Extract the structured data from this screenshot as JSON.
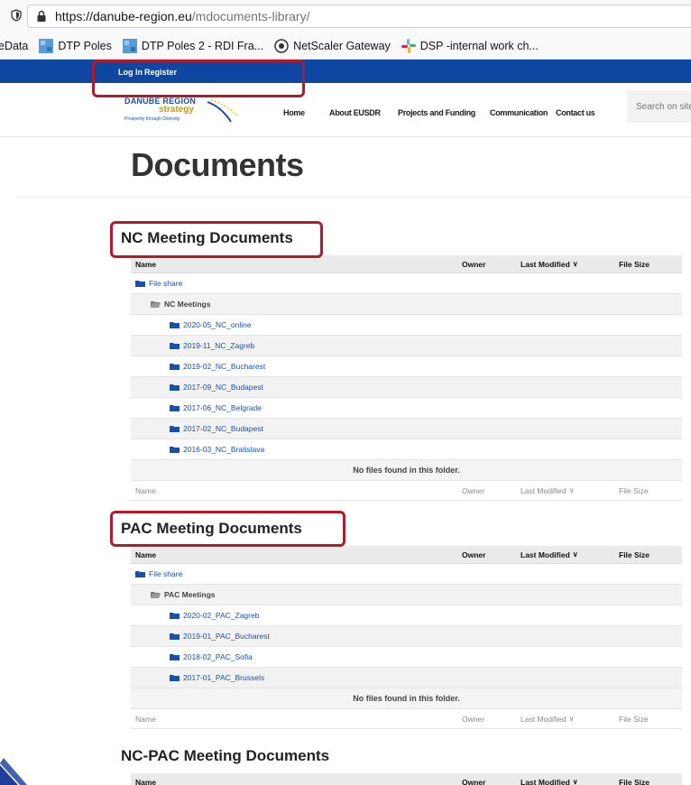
{
  "browser": {
    "url_host": "https://danube-region.eu",
    "url_path": "/mdocuments-library/",
    "bookmarks": [
      "eData",
      "DTP Poles",
      "DTP Poles 2 - RDI Fra...",
      "NetScaler Gateway",
      "DSP -internal work ch..."
    ]
  },
  "site": {
    "login": "Log In",
    "register": "Register",
    "logo_main": "DANUBE REGION",
    "logo_sub": "strategy",
    "logo_tag": "Prosperity through Diversity",
    "nav": [
      "Home",
      "About EUSDR",
      "Projects and Funding",
      "Communication",
      "Contact us"
    ],
    "search_placeholder": "Search on site",
    "page_title": "Documents"
  },
  "columns": {
    "name": "Name",
    "owner": "Owner",
    "modified": "Last Modified",
    "size": "File Size"
  },
  "root_folder": "File share",
  "empty_text": "No files found in this folder.",
  "sections": [
    {
      "title": "NC Meeting Documents",
      "subfolder": "NC Meetings",
      "folders": [
        "2020-05_NC_online",
        "2019-11_NC_Zagreb",
        "2019-02_NC_Bucharest",
        "2017-09_NC_Budapest",
        "2017-06_NC_Belgrade",
        "2017-02_NC_Budapest",
        "2016-03_NC_Bratislava"
      ]
    },
    {
      "title": "PAC Meeting Documents",
      "subfolder": "PAC Meetings",
      "folders": [
        "2020-02_PAC_Zagreb",
        "2019-01_PAC_Bucharest",
        "2018-02_PAC_Sofia",
        "2017-01_PAC_Brussels"
      ]
    },
    {
      "title": "NC-PAC Meeting Documents"
    }
  ],
  "colors": {
    "brand_blue": "#0d47a1",
    "link": "#1b4fa8",
    "annotation_red": "#b01c2e"
  }
}
